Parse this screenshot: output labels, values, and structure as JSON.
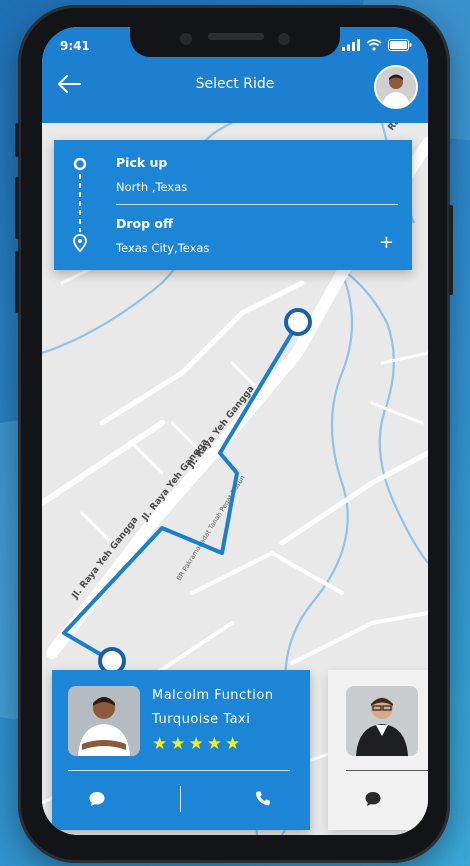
{
  "status_bar": {
    "time": "9:41"
  },
  "header": {
    "title": "Select Ride",
    "back_icon": "arrow-left-icon",
    "avatar_icon": "user-avatar"
  },
  "route": {
    "pickup_label": "Pick up",
    "pickup_value": "North ,Texas",
    "dropoff_label": "Drop off",
    "dropoff_value": "Texas City,Texas",
    "add_icon": "plus-icon"
  },
  "map": {
    "street_labels": [
      {
        "text": "Jl. Raya Yeh Gangga"
      },
      {
        "text": "Jl. Raya Yeh Gangga"
      },
      {
        "text": "Jl. Raya Yeh Gangga"
      },
      {
        "text": "BR Pakramanadat Tanah Pegat Dusun"
      },
      {
        "text": "Raya Ye"
      }
    ],
    "colors": {
      "route": "#1b7fca",
      "water": "#8fc2ec",
      "roads": "#ffffff",
      "land": "#e9e9ea"
    }
  },
  "drivers": [
    {
      "name": "Malcolm Function",
      "company": "Turquoise Taxi",
      "rating": 5,
      "chat_icon": "chat-bubble-icon",
      "call_icon": "phone-icon"
    },
    {
      "chat_icon": "chat-bubble-icon"
    }
  ],
  "colors": {
    "accent": "#1c85d5",
    "star": "#f3ee1e",
    "background_gradient": [
      "#1f6fb3",
      "#3aa7d6"
    ]
  }
}
